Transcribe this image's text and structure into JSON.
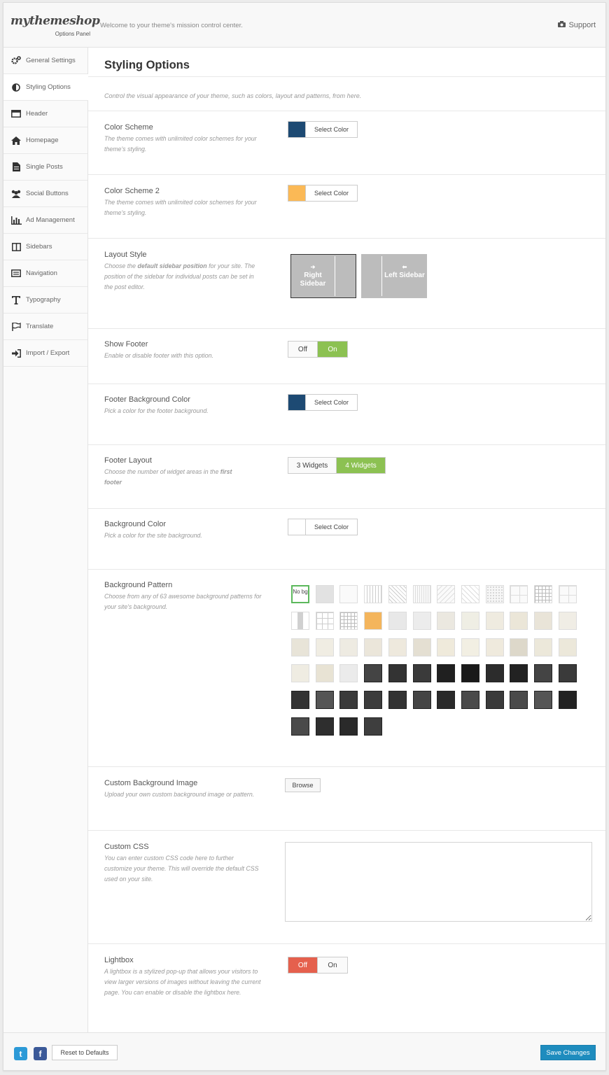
{
  "header": {
    "logo": "mythemeshop",
    "logo_sub": "Options Panel",
    "welcome": "Welcome to your theme's mission control center.",
    "support": "Support"
  },
  "sidebar": {
    "items": [
      {
        "label": "General Settings",
        "icon": "gears-icon"
      },
      {
        "label": "Styling Options",
        "icon": "contrast-icon"
      },
      {
        "label": "Header",
        "icon": "header-icon"
      },
      {
        "label": "Homepage",
        "icon": "home-icon"
      },
      {
        "label": "Single Posts",
        "icon": "document-icon"
      },
      {
        "label": "Social Buttons",
        "icon": "users-icon"
      },
      {
        "label": "Ad Management",
        "icon": "bar-chart-icon"
      },
      {
        "label": "Sidebars",
        "icon": "columns-icon"
      },
      {
        "label": "Navigation",
        "icon": "navigation-icon"
      },
      {
        "label": "Typography",
        "icon": "text-icon"
      },
      {
        "label": "Translate",
        "icon": "flag-icon"
      },
      {
        "label": "Import / Export",
        "icon": "import-icon"
      }
    ],
    "active": "Styling Options"
  },
  "main": {
    "title": "Styling Options",
    "intro": "Control the visual appearance of your theme, such as colors, layout and patterns, from here.",
    "color_scheme": {
      "label": "Color Scheme",
      "desc": "The theme comes with unlimited color schemes for your theme's styling.",
      "button": "Select Color",
      "color": "#1d4a73"
    },
    "color_scheme_2": {
      "label": "Color Scheme 2",
      "desc": "The theme comes with unlimited color schemes for your theme's styling.",
      "button": "Select Color",
      "color": "#fbb956"
    },
    "layout_style": {
      "label": "Layout Style",
      "desc_pre": "Choose the ",
      "desc_bold": "default sidebar position",
      "desc_post": " for your site. The position of the sidebar for individual posts can be set in the post editor.",
      "option_right_arrow": "➔",
      "option_right": "Right Sidebar",
      "option_left_arrow": "⬅",
      "option_left": "Left Sidebar"
    },
    "show_footer": {
      "label": "Show Footer",
      "desc": "Enable or disable footer with this option.",
      "off": "Off",
      "on": "On",
      "value": "On"
    },
    "footer_bg": {
      "label": "Footer Background Color",
      "desc": "Pick a color for the footer background.",
      "button": "Select Color",
      "color": "#1d4a73"
    },
    "footer_layout": {
      "label": "Footer Layout",
      "desc_pre": "Choose the number of widget areas in the ",
      "desc_bold": "first footer",
      "opt1": "3 Widgets",
      "opt2": "4 Widgets",
      "value": "4 Widgets"
    },
    "bg_color": {
      "label": "Background Color",
      "desc": "Pick a color for the site background.",
      "button": "Select Color",
      "color": "#ffffff"
    },
    "bg_pattern": {
      "label": "Background Pattern",
      "desc": "Choose from any of 63 awesome background patterns for your site's background.",
      "nobg": "No bg",
      "selected": "No bg"
    },
    "custom_bg": {
      "label": "Custom Background Image",
      "desc": "Upload your own custom background image or pattern.",
      "button": "Browse"
    },
    "custom_css": {
      "label": "Custom CSS",
      "desc": "You can enter custom CSS code here to further customize your theme. This will override the default CSS used on your site.",
      "value": ""
    },
    "lightbox": {
      "label": "Lightbox",
      "desc": "A lightbox is a stylized pop-up that allows your visitors to view larger versions of images without leaving the current page. You can enable or disable the lightbox here.",
      "off": "Off",
      "on": "On",
      "value": "Off"
    }
  },
  "footer": {
    "reset": "Reset to Defaults",
    "save": "Save Changes",
    "twitter": "t",
    "facebook": "f"
  },
  "colors": {
    "accent_green": "#8cc152",
    "accent_red": "#e5604d",
    "save_blue": "#1e8cbe"
  }
}
